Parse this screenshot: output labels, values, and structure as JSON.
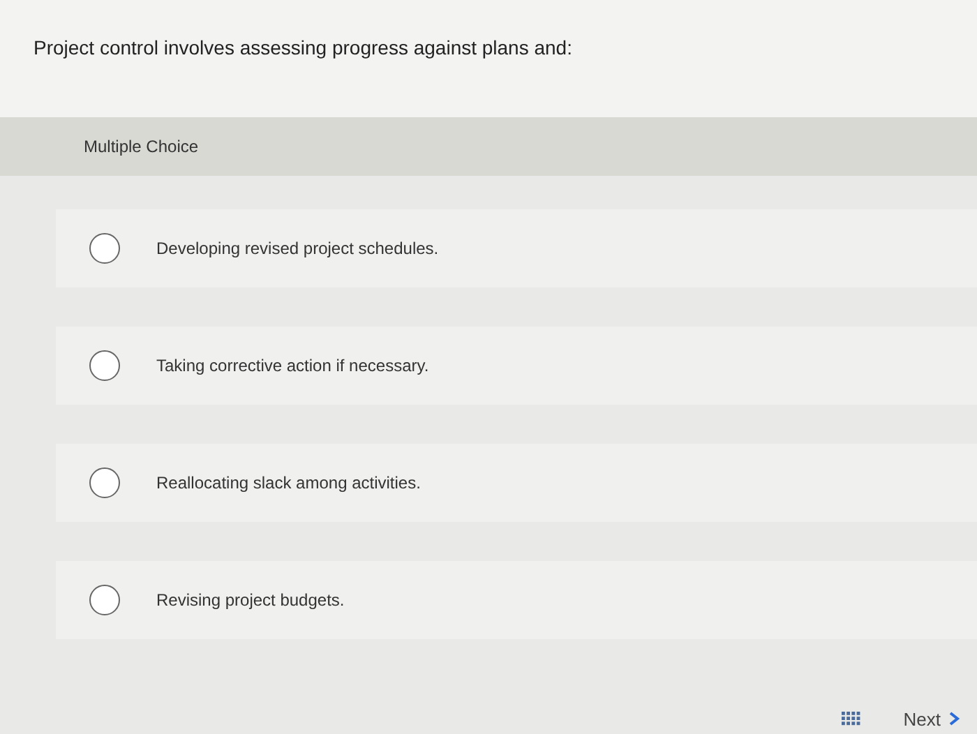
{
  "question": "Project control involves assessing progress against plans and:",
  "type_label": "Multiple Choice",
  "options": [
    {
      "label": "Developing revised project schedules.",
      "selected": false
    },
    {
      "label": "Taking corrective action if necessary.",
      "selected": false
    },
    {
      "label": "Reallocating slack among activities.",
      "selected": false
    },
    {
      "label": "Revising project budgets.",
      "selected": false
    }
  ],
  "next_label": "Next"
}
